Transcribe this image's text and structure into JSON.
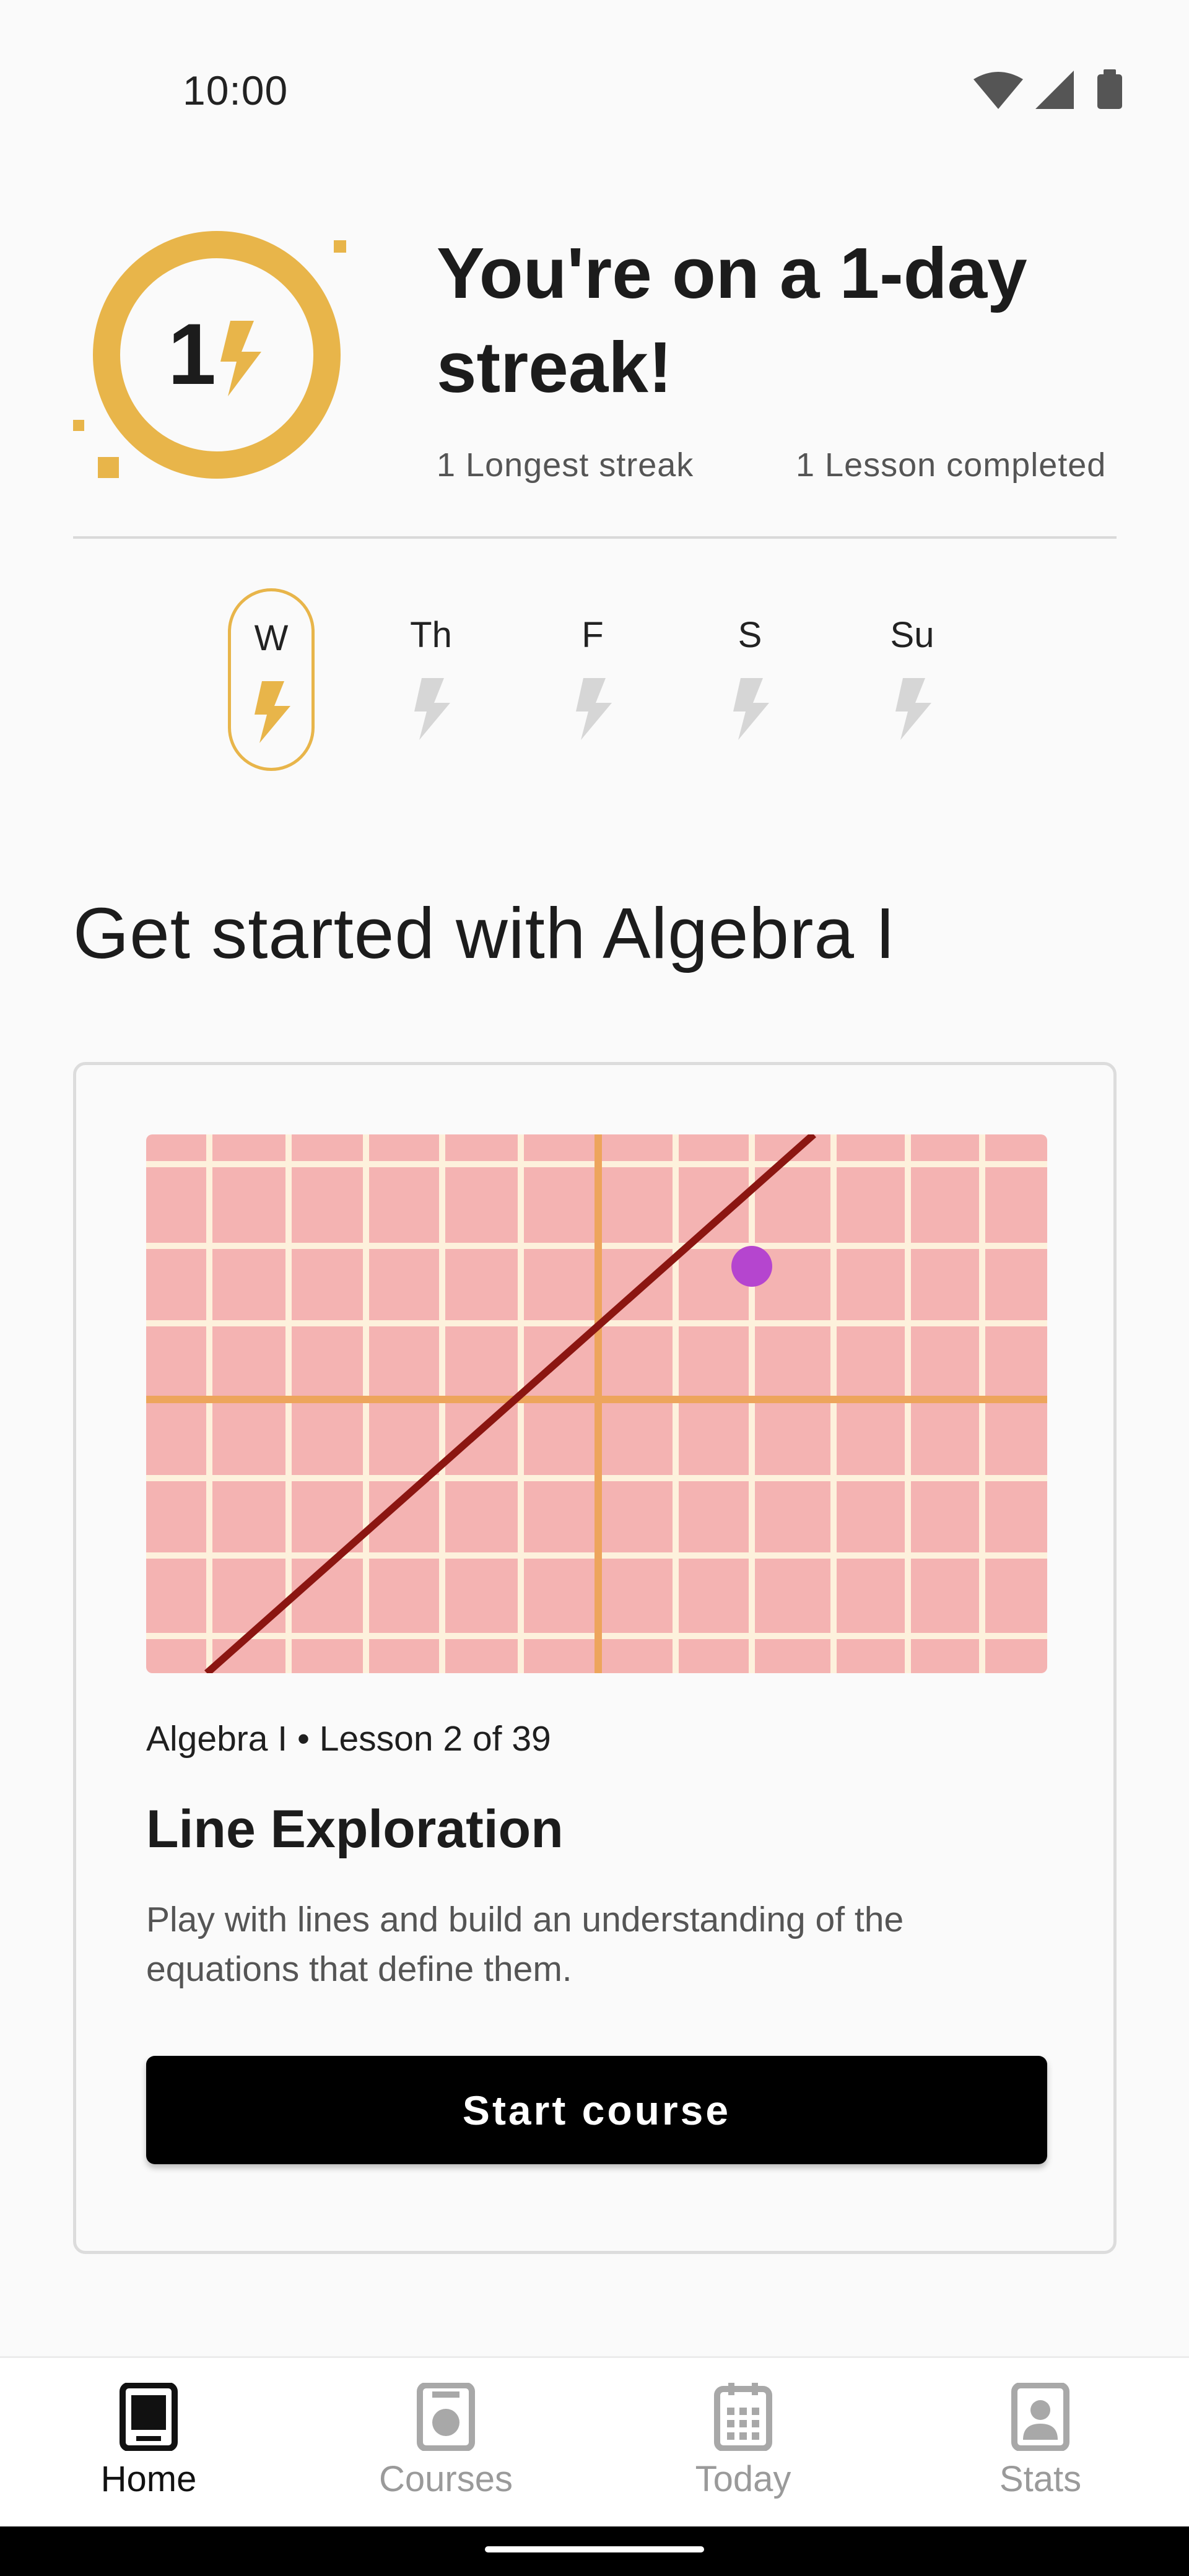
{
  "status_bar": {
    "time": "10:00",
    "icons": [
      "wifi-icon",
      "signal-icon",
      "battery-icon"
    ]
  },
  "streak": {
    "count": "1",
    "title": "You're on a 1-day streak!",
    "longest_streak": "1 Longest streak",
    "lessons_completed": "1 Lesson completed",
    "accent_color": "#e8b54a"
  },
  "week": {
    "days": [
      {
        "label": "W",
        "active": true
      },
      {
        "label": "Th",
        "active": false
      },
      {
        "label": "F",
        "active": false
      },
      {
        "label": "S",
        "active": false
      },
      {
        "label": "Su",
        "active": false
      }
    ]
  },
  "section": {
    "title": "Get started with Algebra I"
  },
  "course_card": {
    "meta": "Algebra I • Lesson 2 of 39",
    "title": "Line Exploration",
    "description": "Play with lines and build an understanding of the equations that define them.",
    "button_label": "Start course",
    "graph_colors": {
      "background": "#f4b3b2",
      "grid": "#fdf1dc",
      "axis": "#eda55c",
      "line": "#8b1611",
      "point": "#b545cf"
    }
  },
  "bottom_nav": {
    "items": [
      {
        "label": "Home",
        "icon": "tablet-icon",
        "active": true
      },
      {
        "label": "Courses",
        "icon": "course-icon",
        "active": false
      },
      {
        "label": "Today",
        "icon": "calendar-icon",
        "active": false
      },
      {
        "label": "Stats",
        "icon": "profile-icon",
        "active": false
      }
    ]
  }
}
